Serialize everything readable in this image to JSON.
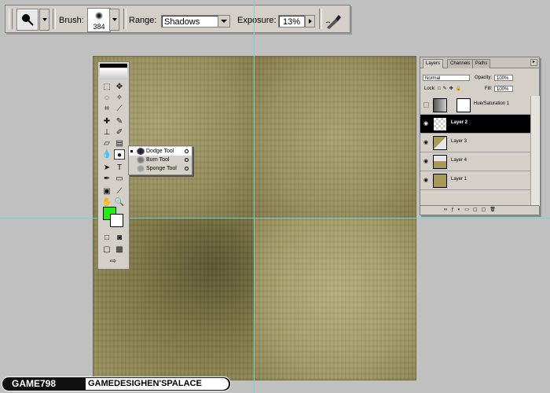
{
  "options_bar": {
    "brush_label": "Brush:",
    "brush_size": "384",
    "range_label": "Range:",
    "range_value": "Shadows",
    "exposure_label": "Exposure:",
    "exposure_value": "13%"
  },
  "tool_flyout": {
    "items": [
      {
        "label": "Dodge Tool",
        "active": true
      },
      {
        "label": "Burn Tool",
        "active": false
      },
      {
        "label": "Sponge Tool",
        "active": false
      }
    ]
  },
  "colors": {
    "foreground": "#22ee11",
    "background": "#ffffff",
    "guide": "#6fd6d0"
  },
  "layers_panel": {
    "tabs": [
      "Layers",
      "Channels",
      "Paths"
    ],
    "blend_mode": "Normal",
    "opacity_label": "Opacity:",
    "opacity_value": "100%",
    "lock_label": "Lock:",
    "fill_label": "Fill:",
    "fill_value": "100%",
    "layers": [
      {
        "name": "Hue/Saturation 1",
        "selected": false
      },
      {
        "name": "Layer 2",
        "selected": true
      },
      {
        "name": "Layer 3",
        "selected": false
      },
      {
        "name": "Layer 4",
        "selected": false
      },
      {
        "name": "Layer 1",
        "selected": false
      }
    ]
  },
  "banner": {
    "left": "GAME798",
    "right": "GAMEDESIGHEN'SPALACE"
  }
}
